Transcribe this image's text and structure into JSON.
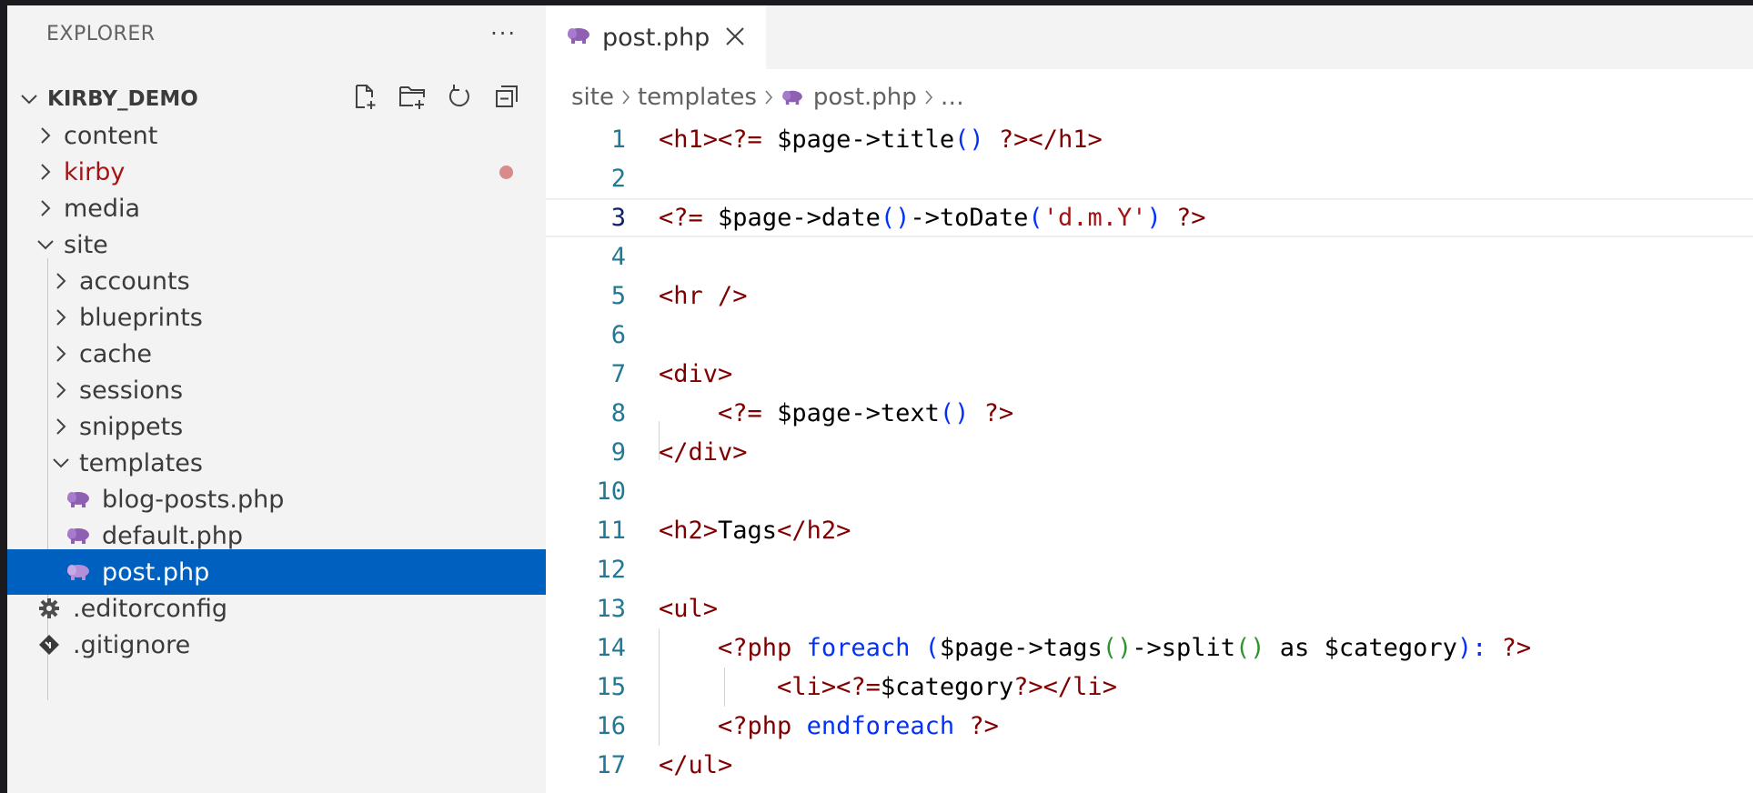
{
  "explorer": {
    "title": "EXPLORER",
    "more": "···",
    "root": "KIRBY_DEMO",
    "items": [
      {
        "label": "content"
      },
      {
        "label": "kirby"
      },
      {
        "label": "media"
      },
      {
        "label": "site"
      },
      {
        "label": "accounts"
      },
      {
        "label": "blueprints"
      },
      {
        "label": "cache"
      },
      {
        "label": "sessions"
      },
      {
        "label": "snippets"
      },
      {
        "label": "templates"
      },
      {
        "label": "blog-posts.php"
      },
      {
        "label": "default.php"
      },
      {
        "label": "post.php"
      },
      {
        "label": ".editorconfig"
      },
      {
        "label": ".gitignore"
      }
    ]
  },
  "tab": {
    "label": "post.php"
  },
  "breadcrumb": {
    "p1": "site",
    "p2": "templates",
    "p3": "post.php",
    "p4": "…"
  },
  "code": {
    "lines": [
      {
        "n": "1"
      },
      {
        "n": "2"
      },
      {
        "n": "3"
      },
      {
        "n": "4"
      },
      {
        "n": "5"
      },
      {
        "n": "6"
      },
      {
        "n": "7"
      },
      {
        "n": "8"
      },
      {
        "n": "9"
      },
      {
        "n": "10"
      },
      {
        "n": "11"
      },
      {
        "n": "12"
      },
      {
        "n": "13"
      },
      {
        "n": "14"
      },
      {
        "n": "15"
      },
      {
        "n": "16"
      },
      {
        "n": "17"
      }
    ],
    "tokens": {
      "l1": [
        "<h1><?=",
        "$page->title",
        "()",
        "?></h1>"
      ],
      "l3": [
        "<?=",
        "$page->date",
        "()",
        "->toDate",
        "(",
        "'d.m.Y'",
        ")",
        "?>"
      ],
      "l5": [
        "<hr />"
      ],
      "l7": [
        "<div>"
      ],
      "l8": [
        "<?=",
        "$page->text",
        "()",
        "?>"
      ],
      "l9": [
        "</div>"
      ],
      "l11": [
        "<h2>",
        "Tags",
        "</h2>"
      ],
      "l13": [
        "<ul>"
      ],
      "l14": [
        "<?php",
        "foreach",
        "(",
        "$page->tags",
        "()",
        "->split",
        "()",
        " as $category",
        "):",
        "?>"
      ],
      "l15": [
        "<li><?=",
        "$category",
        "?></li>"
      ],
      "l16": [
        "<?php",
        "endforeach",
        "?>"
      ],
      "l17": [
        "</ul>"
      ]
    }
  },
  "colors": {
    "selection": "#0060c0",
    "tag": "#800000",
    "keyword": "#0431fa",
    "string": "#a31515",
    "lineNumber": "#237893"
  }
}
